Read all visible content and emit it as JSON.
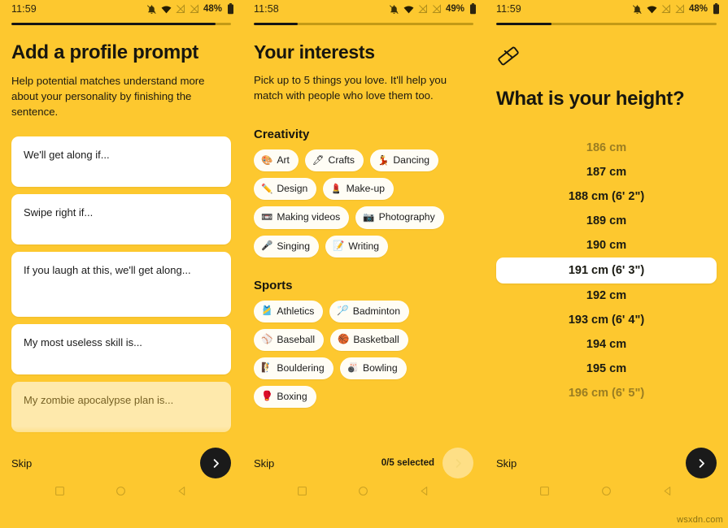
{
  "theme": {
    "background": "#FDC82F",
    "card": "#FFFFFF",
    "chip": "#FFFDF5",
    "text_dark": "#17160F",
    "dim_text": "#9A7D22",
    "progress_track": "#C39A16",
    "progress_fill": "#151515",
    "button_dark": "#1A1A1A"
  },
  "screens": [
    {
      "id": "profile-prompt",
      "status": {
        "time": "11:59",
        "battery_percent": "48%",
        "icons": [
          "notifications-off-icon",
          "wifi-icon",
          "signal-off-icon",
          "signal-off-icon",
          "battery-icon"
        ]
      },
      "progress_percent": 93,
      "title": "Add a profile prompt",
      "subtitle": "Help potential matches understand more about your personality by finishing the sentence.",
      "prompts": [
        "We'll get along if...",
        "Swipe right if...",
        "If you laugh at this, we'll get along...",
        "My most useless skill is...",
        "My zombie apocalypse plan is..."
      ],
      "skip_label": "Skip",
      "next_label": "next-arrow",
      "next_enabled": true
    },
    {
      "id": "your-interests",
      "status": {
        "time": "11:58",
        "battery_percent": "49%",
        "icons": [
          "notifications-off-icon",
          "wifi-icon",
          "signal-off-icon",
          "signal-off-icon",
          "battery-icon"
        ]
      },
      "progress_percent": 20,
      "title": "Your interests",
      "subtitle": "Pick up to 5 things you love. It'll help you match with people who love them too.",
      "sections": [
        {
          "name": "Creativity",
          "chips": [
            {
              "emoji": "🎨",
              "icon": "palette-icon",
              "label": "Art"
            },
            {
              "emoji": "🖊",
              "icon": "pen-icon",
              "label": "Crafts"
            },
            {
              "emoji": "💃",
              "icon": "dancer-icon",
              "label": "Dancing"
            },
            {
              "emoji": "✏️",
              "icon": "pencil-icon",
              "label": "Design"
            },
            {
              "emoji": "💄",
              "icon": "lipstick-icon",
              "label": "Make-up"
            },
            {
              "emoji": "📼",
              "icon": "videotape-icon",
              "label": "Making videos"
            },
            {
              "emoji": "📷",
              "icon": "camera-icon",
              "label": "Photography"
            },
            {
              "emoji": "🎤",
              "icon": "microphone-icon",
              "label": "Singing"
            },
            {
              "emoji": "📝",
              "icon": "memo-icon",
              "label": "Writing"
            }
          ]
        },
        {
          "name": "Sports",
          "chips": [
            {
              "emoji": "🎽",
              "icon": "running-shirt-icon",
              "label": "Athletics"
            },
            {
              "emoji": "🏸",
              "icon": "badminton-icon",
              "label": "Badminton"
            },
            {
              "emoji": "⚾",
              "icon": "baseball-icon",
              "label": "Baseball"
            },
            {
              "emoji": "🏀",
              "icon": "basketball-icon",
              "label": "Basketball"
            },
            {
              "emoji": "🧗",
              "icon": "climbing-icon",
              "label": "Bouldering"
            },
            {
              "emoji": "🎳",
              "icon": "bowling-icon",
              "label": "Bowling"
            },
            {
              "emoji": "🥊",
              "icon": "boxing-glove-icon",
              "label": "Boxing"
            }
          ]
        }
      ],
      "skip_label": "Skip",
      "selected_count": "0/5 selected",
      "next_label": "next-arrow",
      "next_enabled": false
    },
    {
      "id": "height",
      "status": {
        "time": "11:59",
        "battery_percent": "48%",
        "icons": [
          "notifications-off-icon",
          "wifi-icon",
          "signal-off-icon",
          "signal-off-icon",
          "battery-icon"
        ]
      },
      "progress_percent": 25,
      "header_icon": "ruler-icon",
      "title": "What is your height?",
      "height_options": [
        {
          "label": "186 cm",
          "state": "dim"
        },
        {
          "label": "187 cm",
          "state": "normal"
        },
        {
          "label": "188 cm (6' 2\")",
          "state": "normal"
        },
        {
          "label": "189 cm",
          "state": "normal"
        },
        {
          "label": "190 cm",
          "state": "normal"
        },
        {
          "label": "191 cm (6' 3\")",
          "state": "selected"
        },
        {
          "label": "192 cm",
          "state": "normal"
        },
        {
          "label": "193 cm (6' 4\")",
          "state": "normal"
        },
        {
          "label": "194 cm",
          "state": "normal"
        },
        {
          "label": "195 cm",
          "state": "normal"
        },
        {
          "label": "196 cm (6' 5\")",
          "state": "dim"
        }
      ],
      "skip_label": "Skip",
      "next_label": "next-arrow",
      "next_enabled": true
    }
  ],
  "navbar": {
    "items": [
      "recents-square-icon",
      "home-circle-icon",
      "back-triangle-icon"
    ]
  },
  "watermark": "wsxdn.com"
}
